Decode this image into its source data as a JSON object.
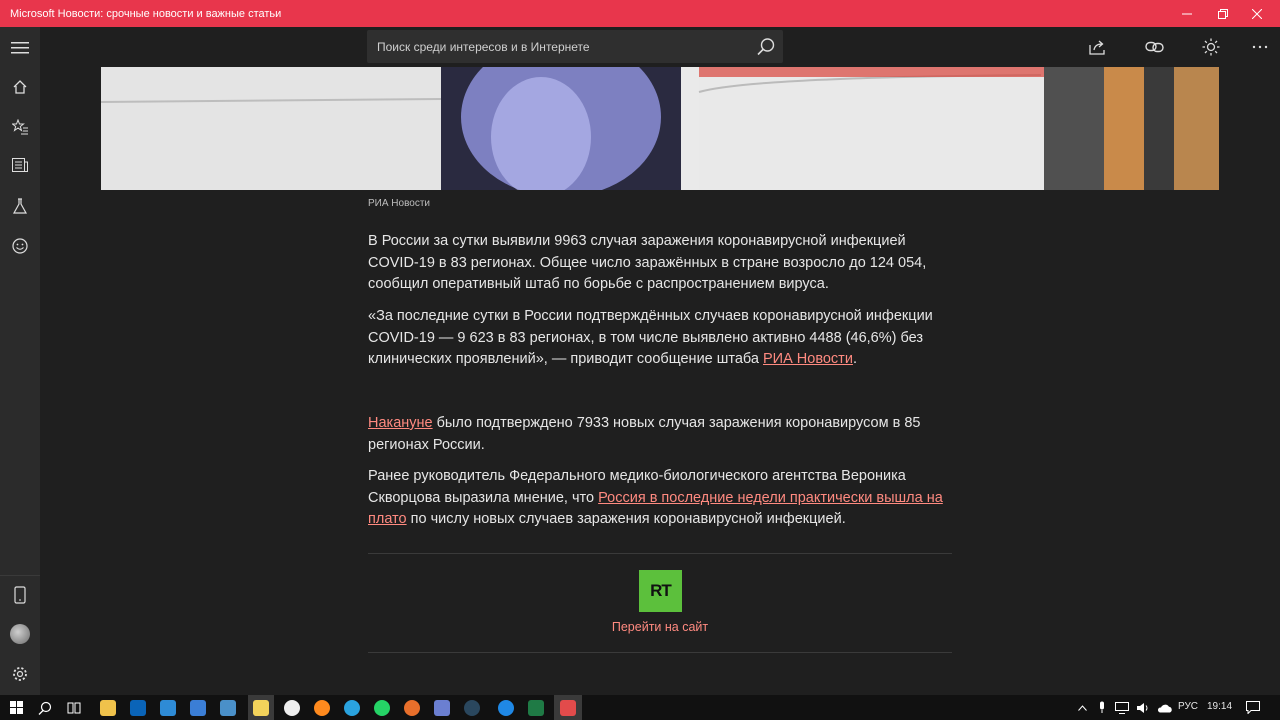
{
  "window": {
    "title": "Microsoft Новости: срочные новости и важные статьи",
    "accent": "#e8364c"
  },
  "search": {
    "placeholder": "Поиск среди интересов и в Интернете"
  },
  "header_icons": [
    "share-icon",
    "link-icon",
    "brightness-icon",
    "more-icon"
  ],
  "rail": {
    "top_items": [
      "menu-icon",
      "home-icon",
      "favorites-icon",
      "news-icon",
      "interests-icon",
      "emoji-icon"
    ],
    "bottom_items": [
      "phone-icon",
      "avatar",
      "settings-icon"
    ]
  },
  "article": {
    "image_caption": "РИА Новости",
    "p1": "В России за сутки выявили 9963 случая заражения коронавирусной инфекцией COVID-19 в 83 регионах. Общее число заражённых в стране возросло до 124 054, сообщил оперативный штаб по борьбе с распространением вируса.",
    "p2_text": "«За последние сутки в России подтверждённых случаев коронавирусной инфекции COVID-19 — 9 623 в 83 регионах, в том числе выявлено активно 4488 (46,6%) без клинических проявлений», — приводит сообщение штаба ",
    "p2_link": "РИА Новости",
    "p2_end": ".",
    "p3_link": "Накануне",
    "p3_text": " было подтверждено 7933 новых случая заражения коронавирусом в 85 регионах России.",
    "p4_text": "Ранее руководитель Федерального медико-биологического агентства Вероника Скворцова выразила мнение, что ",
    "p4_link": "Россия в последние недели практически вышла на плато",
    "p4_end": " по числу новых случаев заражения коронавирусной инфекцией.",
    "source_logo": "RT",
    "goto_label": "Перейти на сайт",
    "link_color": "#ff8a80"
  },
  "taskbar": {
    "lang": "РУС",
    "time": "19:14"
  }
}
